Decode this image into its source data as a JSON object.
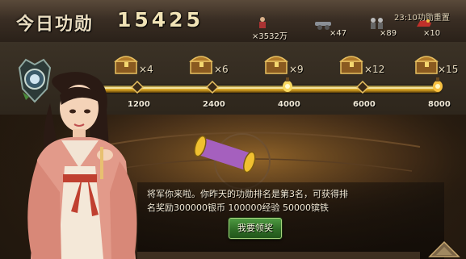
{
  "header": {
    "title": "今日功勋",
    "score": "15425",
    "reset_text": "23:10功勋重置"
  },
  "resources": [
    {
      "icon": "soldier-icon",
      "value": "×3532万"
    },
    {
      "icon": "cannon-icon",
      "value": "×47"
    },
    {
      "icon": "infantry-icon",
      "value": "×89"
    },
    {
      "icon": "cavalry-icon",
      "value": "×10"
    }
  ],
  "milestones": [
    {
      "threshold": "1200",
      "chest_count": "×4"
    },
    {
      "threshold": "2400",
      "chest_count": "×6"
    },
    {
      "threshold": "4000",
      "chest_count": "×9"
    },
    {
      "threshold": "6000",
      "chest_count": "×12"
    },
    {
      "threshold": "8000",
      "chest_count": "×15"
    }
  ],
  "progress": {
    "current": 15425,
    "max": 8000,
    "fill_fraction": 1.0
  },
  "dialog": {
    "line1": "将军你来啦。你昨天的功勋排名是第3名，可获得排",
    "line2": "名奖励300000银币  100000经验  50000镔铁",
    "claim_label": "我要领奖"
  },
  "colors": {
    "track": "#d9a420",
    "claim_button": "#2f6d26",
    "header_text": "#f1e3b6"
  }
}
